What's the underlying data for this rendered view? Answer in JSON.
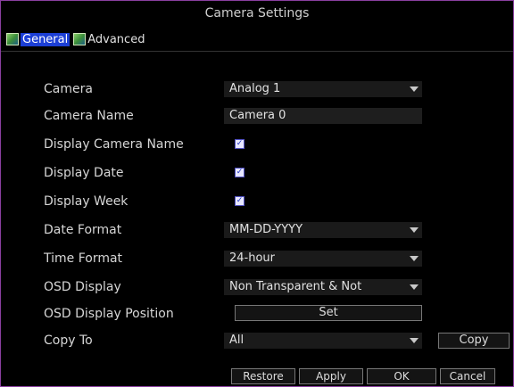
{
  "window": {
    "title": "Camera Settings"
  },
  "tabs": [
    {
      "label": "General",
      "active": true
    },
    {
      "label": "Advanced",
      "active": false
    }
  ],
  "form": {
    "camera": {
      "label": "Camera",
      "value": "Analog 1"
    },
    "camera_name": {
      "label": "Camera Name",
      "value": "Camera 0"
    },
    "display_camera_name": {
      "label": "Display Camera Name",
      "checked": true
    },
    "display_date": {
      "label": "Display Date",
      "checked": true
    },
    "display_week": {
      "label": "Display Week",
      "checked": true
    },
    "date_format": {
      "label": "Date Format",
      "value": "MM-DD-YYYY"
    },
    "time_format": {
      "label": "Time Format",
      "value": "24-hour"
    },
    "osd_display": {
      "label": "OSD Display",
      "value": "Non Transparent & Not"
    },
    "osd_display_position": {
      "label": "OSD Display Position",
      "button": "Set"
    },
    "copy_to": {
      "label": "Copy To",
      "value": "All",
      "button": "Copy"
    }
  },
  "buttons": {
    "restore": "Restore",
    "apply": "Apply",
    "ok": "OK",
    "cancel": "Cancel"
  },
  "colors": {
    "border": "#8a3fa0",
    "active_tab": "#1c3fd6",
    "background": "#000000"
  }
}
